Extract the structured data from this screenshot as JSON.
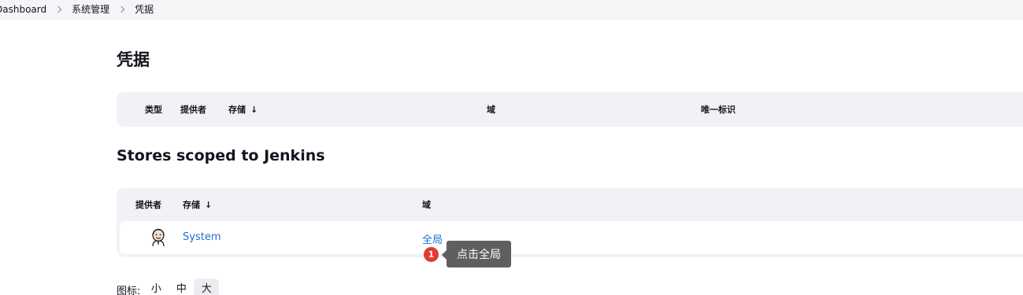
{
  "breadcrumb": {
    "items": [
      "Dashboard",
      "系统管理",
      "凭据"
    ]
  },
  "page": {
    "title": "凭据"
  },
  "credentials_table": {
    "headers": {
      "type": "类型",
      "provider": "提供者",
      "store": "存储",
      "sort_indicator": "↓",
      "domain": "域",
      "id": "唯一标识"
    }
  },
  "stores": {
    "title": "Stores scoped to Jenkins",
    "headers": {
      "provider": "提供者",
      "store": "存储",
      "sort_indicator": "↓",
      "domain": "域"
    },
    "rows": [
      {
        "icon": "jenkins-icon",
        "store": "System",
        "domain": "全局"
      }
    ]
  },
  "annotation": {
    "step": "1",
    "text": "点击全局"
  },
  "icon_size": {
    "label": "图标:",
    "options": [
      "小",
      "中",
      "大"
    ],
    "selected": "大"
  },
  "colors": {
    "link": "#1e6fd9",
    "header_bg": "#f2f2f6",
    "badge": "#e53935",
    "tooltip_bg": "#5f5f5f"
  }
}
